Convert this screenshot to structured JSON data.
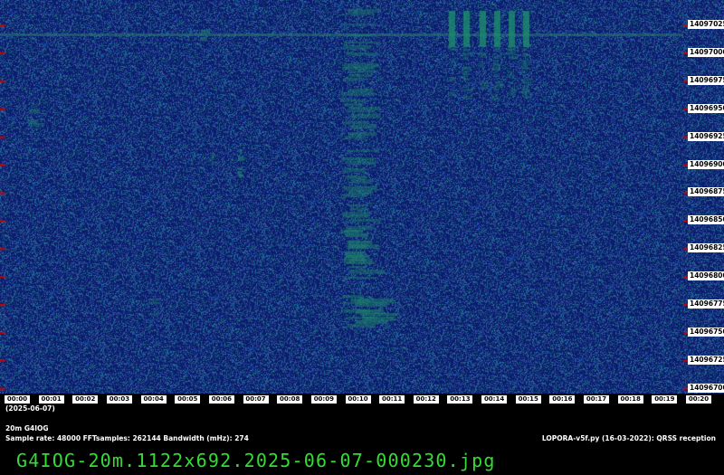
{
  "freq_labels": [
    "14097025",
    "14097000",
    "14096975",
    "14096950",
    "14096925",
    "14096900",
    "14096875",
    "14096850",
    "14096825",
    "14096800",
    "14096775",
    "14096750",
    "14096725",
    "14096700"
  ],
  "time_labels": [
    "00:00",
    "00:01",
    "00:02",
    "00:03",
    "00:04",
    "00:05",
    "00:06",
    "00:07",
    "00:08",
    "00:09",
    "00:10",
    "00:11",
    "00:12",
    "00:13",
    "00:14",
    "00:15",
    "00:16",
    "00:17",
    "00:18",
    "00:19",
    "00:20"
  ],
  "date_label": "(2025-06-07)",
  "band_call": "20m G4IOG",
  "params": "Sample rate: 48000    FFTsamples: 262144    Bandwidth (mHz): 274",
  "software": "LOPORA-v5f.py (16-03-2022): QRSS reception",
  "filename": "G4IOG-20m.1122x692.2025-06-07-000230.jpg",
  "colors": {
    "background": "#0c1c6e",
    "signal": "#1a7a6a",
    "marker": "#cc0000",
    "filename_text": "#33dd33"
  }
}
